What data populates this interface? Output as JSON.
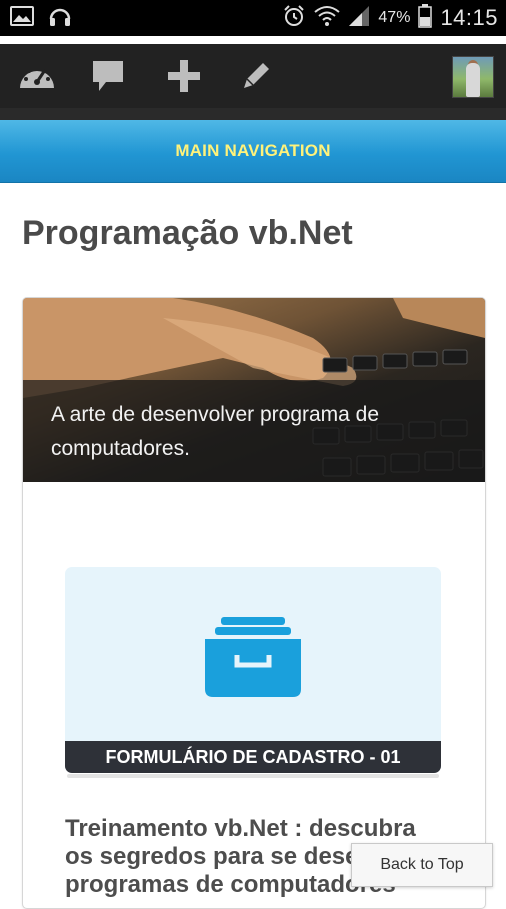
{
  "status_bar": {
    "battery_percent": "47%",
    "time": "14:15",
    "icons": [
      "image-icon",
      "headset-icon",
      "alarm-icon",
      "wifi-icon",
      "signal-icon",
      "battery-icon"
    ]
  },
  "admin_bar": {
    "icons": [
      "dashboard-icon",
      "comments-icon",
      "add-new-icon",
      "edit-icon"
    ]
  },
  "main_nav": {
    "label": "MAIN NAVIGATION"
  },
  "page": {
    "title": "Programação vb.Net"
  },
  "hero": {
    "caption": "A arte de desenvolver programa de computadores."
  },
  "post": {
    "thumbnail_label": "FORMULÁRIO DE CADASTRO - 01",
    "title": "Treinamento vb.Net : descubra os segredos para se desenvolver programas de computadores"
  },
  "back_to_top": {
    "label": "Back to Top"
  },
  "colors": {
    "nav_gradient_top": "#4fb8e6",
    "nav_gradient_bottom": "#1a86c3",
    "nav_text": "#fff27a",
    "admin_bar": "#222222",
    "icon_blue": "#1aa0dc"
  }
}
